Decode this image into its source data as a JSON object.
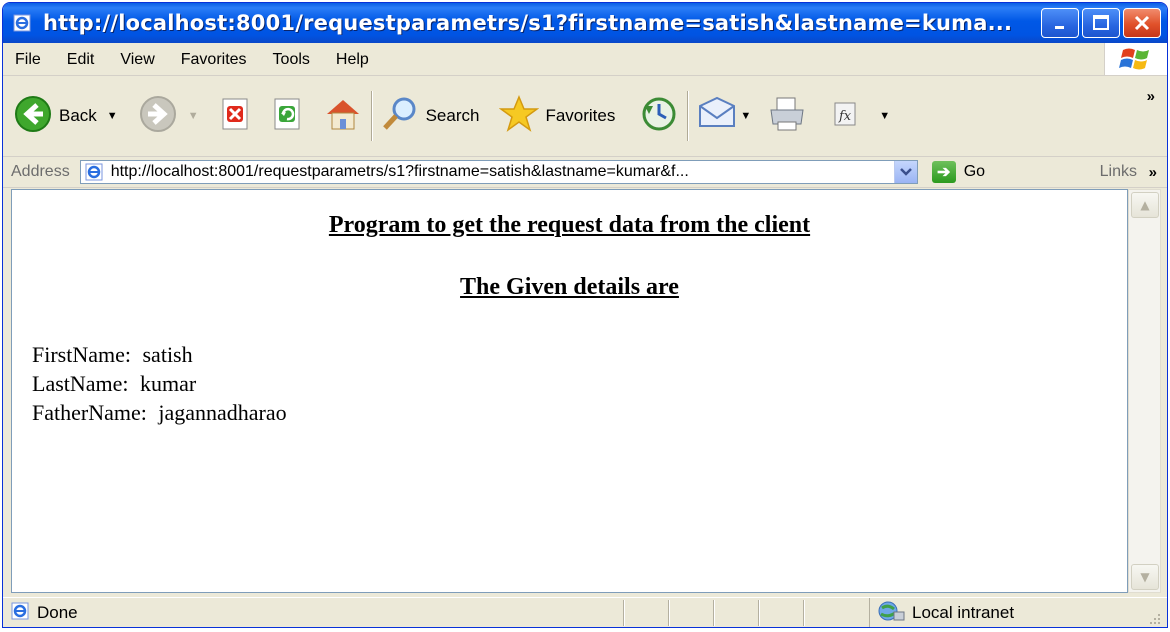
{
  "window": {
    "title": "http://localhost:8001/requestparametrs/s1?firstname=satish&lastname=kuma..."
  },
  "menu": [
    "File",
    "Edit",
    "View",
    "Favorites",
    "Tools",
    "Help"
  ],
  "toolbar": {
    "back_label": "Back",
    "search_label": "Search",
    "favorites_label": "Favorites"
  },
  "address": {
    "label": "Address",
    "url": "http://localhost:8001/requestparametrs/s1?firstname=satish&lastname=kumar&f...",
    "go_label": "Go",
    "links_label": "Links"
  },
  "page": {
    "heading": "Program to get the request data from the client",
    "subheading": "The Given details are",
    "details": [
      {
        "key": "FirstName:",
        "value": "satish"
      },
      {
        "key": "LastName:",
        "value": "kumar"
      },
      {
        "key": "FatherName:",
        "value": "jagannadharao"
      }
    ]
  },
  "status": {
    "text": "Done",
    "zone": "Local intranet"
  },
  "colors": {
    "titlebar": "#0054e3",
    "chrome": "#ece9d8",
    "close_button": "#e0512a"
  }
}
